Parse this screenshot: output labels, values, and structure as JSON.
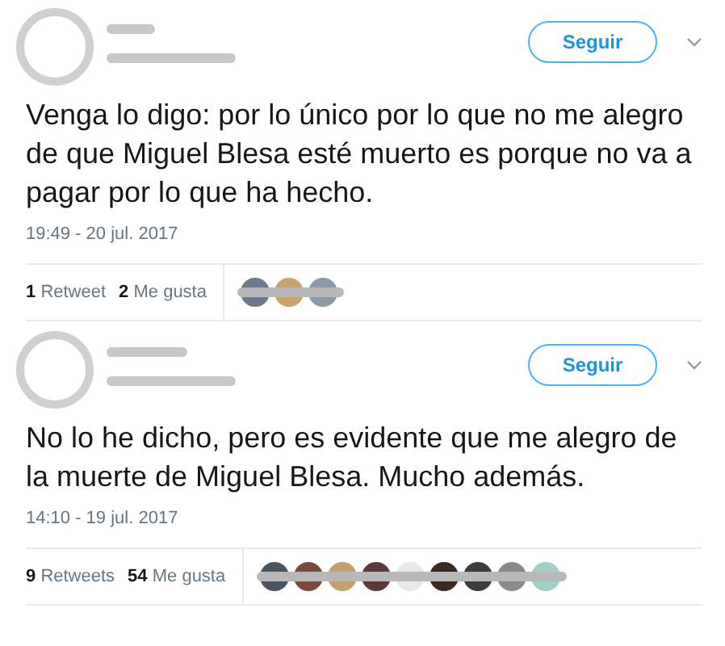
{
  "tweets": [
    {
      "follow_label": "Seguir",
      "text": "Venga lo digo: por lo único por lo que no me alegro de que Miguel Blesa esté muerto es porque no va a pagar por lo que ha hecho.",
      "timestamp": "19:49 - 20 jul. 2017",
      "stats": [
        {
          "count": "1",
          "label": "Retweet"
        },
        {
          "count": "2",
          "label": "Me gusta"
        }
      ],
      "liker_avatars": [
        {
          "color": "#6a7a8c"
        },
        {
          "color": "#c9a46a"
        },
        {
          "color": "#8c9aa6"
        }
      ]
    },
    {
      "follow_label": "Seguir",
      "text": "No lo he dicho, pero es evidente que me alegro de la muerte de Miguel Blesa. Mucho además.",
      "timestamp": "14:10 - 19 jul. 2017",
      "stats": [
        {
          "count": "9",
          "label": "Retweets"
        },
        {
          "count": "54",
          "label": "Me gusta"
        }
      ],
      "liker_avatars": [
        {
          "color": "#4a5560"
        },
        {
          "color": "#7a4a3a"
        },
        {
          "color": "#c4a070"
        },
        {
          "color": "#5a3a3a"
        },
        {
          "color": "#e8e8e8"
        },
        {
          "color": "#3a2a24"
        },
        {
          "color": "#3c3c3c"
        },
        {
          "color": "#8a8a8a"
        },
        {
          "color": "#9fd0c8"
        }
      ]
    }
  ]
}
